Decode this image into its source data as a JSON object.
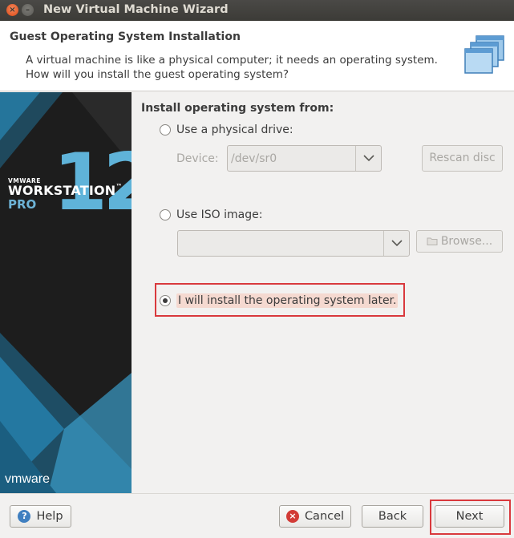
{
  "window": {
    "title": "New Virtual Machine Wizard"
  },
  "header": {
    "title": "Guest Operating System Installation",
    "description_line1": "A virtual machine is like a physical computer; it needs an operating system.",
    "description_line2": "How will you install the guest operating system?"
  },
  "banner": {
    "vmware_small": "VMWARE",
    "product": "WORKSTATION",
    "tm": "™",
    "edition": "PRO",
    "version": "12",
    "logo": "vmware"
  },
  "main": {
    "section_label": "Install operating system from:",
    "options": {
      "physical_drive": {
        "label": "Use a physical drive:",
        "selected": false
      },
      "iso_image": {
        "label": "Use ISO image:",
        "selected": false
      },
      "install_later": {
        "label": "I will install the operating system later.",
        "selected": true
      }
    },
    "device_label": "Device:",
    "device_value": "/dev/sr0",
    "iso_value": "",
    "rescan_label": "Rescan disc",
    "browse_label": "Browse..."
  },
  "footer": {
    "help_label": "Help",
    "cancel_label": "Cancel",
    "back_label": "Back",
    "next_label": "Next"
  },
  "colors": {
    "accent_highlight": "#d9393d",
    "banner_blue": "#5fb3d9",
    "title_bar": "#3c3b37"
  },
  "icons": {
    "close": "close-icon",
    "minimize": "minimize-icon",
    "header": "virtual-machine-icon",
    "help": "help-icon",
    "cancel": "cancel-icon",
    "browse": "folder-icon",
    "dropdown": "chevron-down-icon"
  }
}
